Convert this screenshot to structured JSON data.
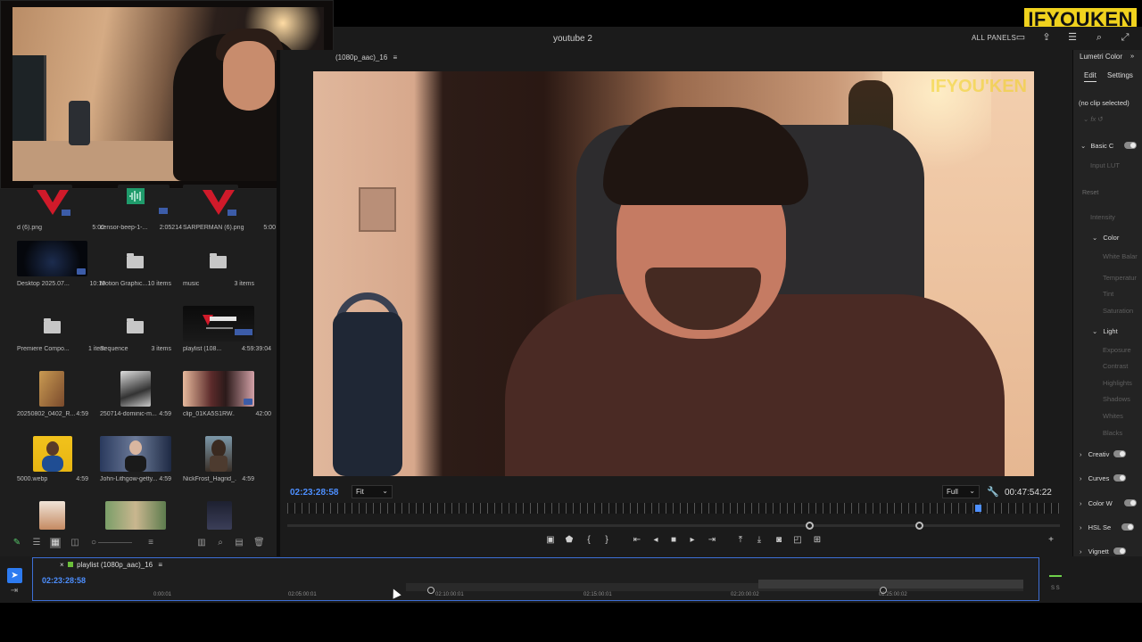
{
  "brand": {
    "logo": "IFYOUKEN"
  },
  "header": {
    "title": "youtube 2",
    "all_panels": "ALL PANELS"
  },
  "project": {
    "items": [
      {
        "name": "d (6).png",
        "meta": "5:00"
      },
      {
        "name": "censor-beep-1-...",
        "meta": "2:05214"
      },
      {
        "name": "SARPERMAN (6).png",
        "meta": "5:00"
      },
      {
        "name": "Desktop 2025.07...",
        "meta": "10:19"
      },
      {
        "name": "Motion Graphic...",
        "meta": "10 items"
      },
      {
        "name": "music",
        "meta": "3 items"
      },
      {
        "name": "Premiere Compo...",
        "meta": "1 item"
      },
      {
        "name": "Sequence",
        "meta": "3 items"
      },
      {
        "name": "playlist (108...",
        "meta": "4:59:39:04"
      },
      {
        "name": "20250802_0402_R...",
        "meta": "4:59"
      },
      {
        "name": "250714-dominic-m...",
        "meta": "4:59"
      },
      {
        "name": "clip_01KA5S1RW...",
        "meta": "42:00"
      },
      {
        "name": "5000.webp",
        "meta": "4:59"
      },
      {
        "name": "John-Lithgow-getty...",
        "meta": "4:59"
      },
      {
        "name": "NickFrost_Hagrid_...",
        "meta": "4:59"
      }
    ]
  },
  "monitor": {
    "tab": "(1080p_aac)_16",
    "timecode_current": "02:23:28:58",
    "fit": "Fit",
    "quality": "Full",
    "timecode_duration": "00:47:54:22",
    "overlay_logo": "IFYOU'KEN"
  },
  "lumetri": {
    "title": "Lumetri Color",
    "tabs": [
      "Edit",
      "Settings"
    ],
    "no_clip": "(no clip selected)",
    "sections": {
      "basic": "Basic C",
      "input_lut": "Input LUT",
      "reset": "Reset",
      "intensity": "Intensity",
      "color": "Color",
      "white_balance": "White Balar",
      "temperature": "Temperatur",
      "tint": "Tint",
      "saturation": "Saturation",
      "light": "Light",
      "exposure": "Exposure",
      "contrast": "Contrast",
      "highlights": "Highlights",
      "shadows": "Shadows",
      "whites": "Whites",
      "blacks": "Blacks",
      "creative": "Creativ",
      "curves": "Curves",
      "color_wheels": "Color W",
      "hsl": "HSL Se",
      "vignette": "Vignett"
    }
  },
  "timeline": {
    "tab": "playlist (1080p_aac)_16",
    "timecode": "02:23:28:58",
    "ticks": [
      "0:00:01",
      "02:05:00:01",
      "02:10:00:01",
      "02:15:00:01",
      "02:20:00:02",
      "02:25:00:02"
    ],
    "meter_label": "S S"
  },
  "colors": {
    "accent_blue": "#4d8fff",
    "brand_yellow": "#f0d21e",
    "panel_bg": "#1b1b1b"
  }
}
